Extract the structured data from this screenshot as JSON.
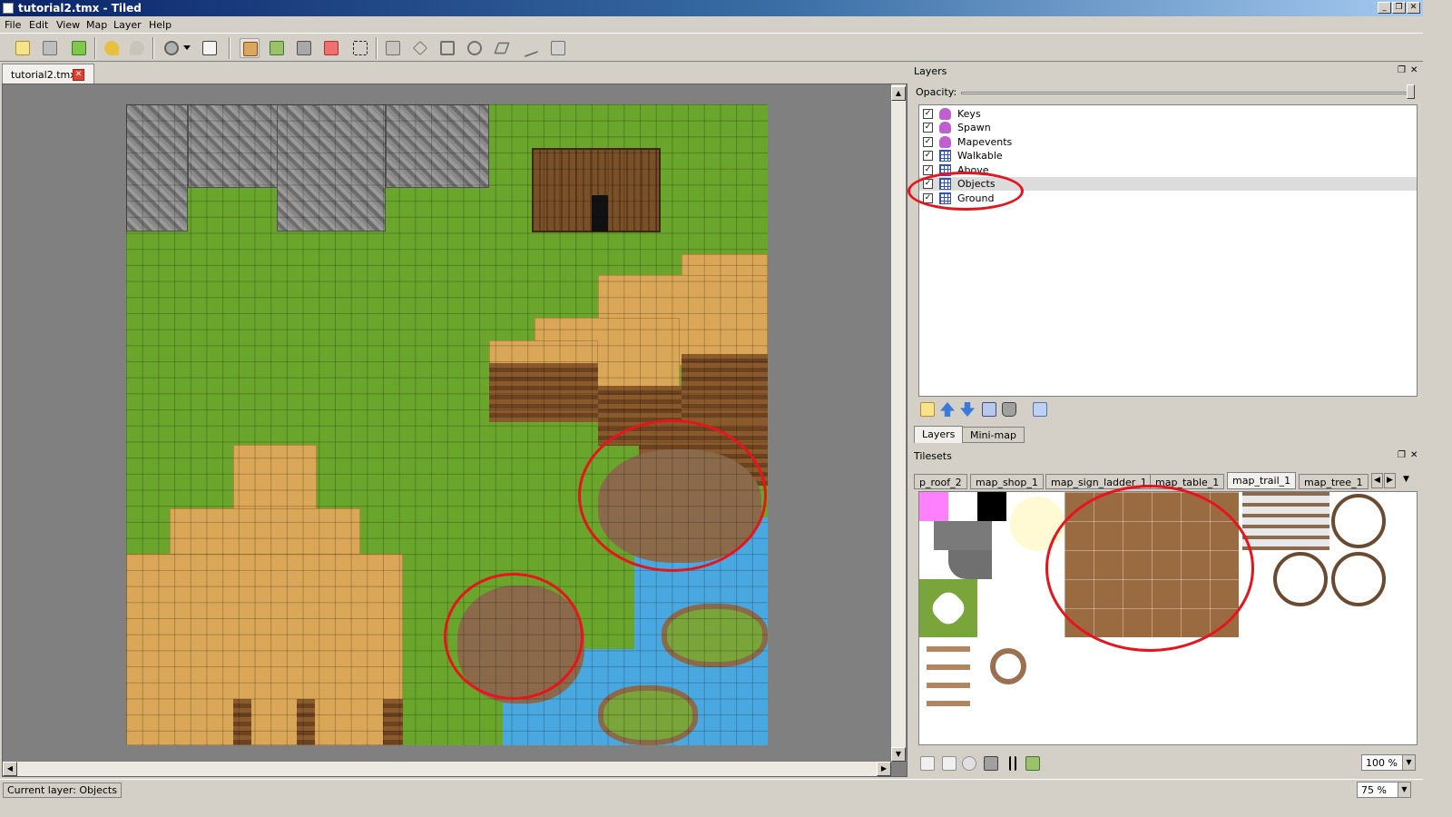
{
  "window": {
    "title": "tutorial2.tmx - Tiled",
    "controls": [
      "_",
      "❐",
      "✕"
    ]
  },
  "menu": [
    "File",
    "Edit",
    "View",
    "Map",
    "Layer",
    "Help"
  ],
  "toolbar": {
    "icons": [
      "new-map-icon",
      "open-file-icon",
      "save-file-icon",
      "undo-icon",
      "redo-icon",
      "command-icon",
      "dropdown-arrow-icon",
      "random-dice-icon",
      "stamp-brush-icon",
      "terrain-brush-icon",
      "bucket-fill-icon",
      "eraser-icon",
      "rectangle-select-icon",
      "select-objects-icon",
      "edit-polygon-icon",
      "insert-rectangle-icon",
      "insert-ellipse-icon",
      "insert-polygon-icon",
      "insert-polyline-icon",
      "insert-tile-icon"
    ],
    "active": [
      "stamp-brush-icon"
    ]
  },
  "document": {
    "tab_label": "tutorial2.tmx",
    "close_glyph": "✕"
  },
  "scroll": {
    "up": "▲",
    "down": "▼",
    "left": "◀",
    "right": "▶"
  },
  "layers_panel": {
    "title": "Layers",
    "controls": [
      "❐",
      "✕"
    ],
    "opacity_label": "Opacity:",
    "opacity": 1.0,
    "layers": [
      {
        "name": "Keys",
        "type": "object",
        "visible": true,
        "selected": false
      },
      {
        "name": "Spawn",
        "type": "object",
        "visible": true,
        "selected": false
      },
      {
        "name": "Mapevents",
        "type": "object",
        "visible": true,
        "selected": false
      },
      {
        "name": "Walkable",
        "type": "tile",
        "visible": true,
        "selected": false
      },
      {
        "name": "Above",
        "type": "tile",
        "visible": true,
        "selected": false
      },
      {
        "name": "Objects",
        "type": "tile",
        "visible": true,
        "selected": true
      },
      {
        "name": "Ground",
        "type": "tile",
        "visible": true,
        "selected": false
      }
    ],
    "buttons": [
      "add-layer-icon",
      "move-layer-up-icon",
      "move-layer-down-icon",
      "duplicate-layer-icon",
      "delete-layer-icon",
      "toggle-other-layers-icon"
    ],
    "tabs": [
      {
        "label": "Layers",
        "active": true
      },
      {
        "label": "Mini-map",
        "active": false
      }
    ]
  },
  "tilesets_panel": {
    "title": "Tilesets",
    "controls": [
      "❐",
      "✕"
    ],
    "tabs": [
      "p_roof_2",
      "map_shop_1",
      "map_sign_ladder_1",
      "map_table_1",
      "map_trail_1",
      "map_tree_1"
    ],
    "active_tab": "map_trail_1",
    "nav": [
      "◀",
      "▶",
      "▼"
    ],
    "buttons": [
      "new-tileset-icon",
      "import-tileset-icon",
      "export-tileset-icon",
      "remove-tileset-icon",
      "tileset-properties-icon",
      "edit-terrain-icon"
    ],
    "zoom": "100 %"
  },
  "map_zoom": "75 %",
  "status": {
    "current_layer": "Current layer: Objects"
  },
  "colors": {
    "annotation": "#e8141c",
    "grass": "#6aa52c",
    "sand": "#d9a757",
    "water": "#4aa8e0"
  }
}
